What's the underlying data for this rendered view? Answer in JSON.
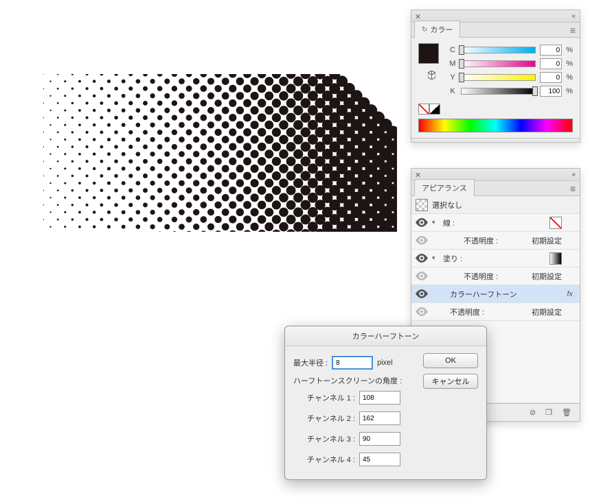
{
  "panels": {
    "color": {
      "tab_label": "カラー",
      "channels": {
        "c": {
          "label": "C",
          "value": "0",
          "pct": "%"
        },
        "m": {
          "label": "M",
          "value": "0",
          "pct": "%"
        },
        "y": {
          "label": "Y",
          "value": "0",
          "pct": "%"
        },
        "k": {
          "label": "K",
          "value": "100",
          "pct": "%"
        }
      }
    },
    "appearance": {
      "tab_label": "アピアランス",
      "selection_label": "選択なし",
      "rows": {
        "stroke_label": "線 :",
        "opacity_label": "不透明度 :",
        "opacity_value": "初期設定",
        "fill_label": "塗り :",
        "effect_label": "カラーハーフトーン"
      }
    }
  },
  "dialog": {
    "title": "カラーハーフトーン",
    "max_radius_label": "最大半径 :",
    "max_radius_value": "8",
    "max_radius_unit": "pixel",
    "angles_label": "ハーフトーンスクリーンの角度 :",
    "channels": [
      {
        "label": "チャンネル 1 :",
        "value": "108"
      },
      {
        "label": "チャンネル 2 :",
        "value": "162"
      },
      {
        "label": "チャンネル 3 :",
        "value": "90"
      },
      {
        "label": "チャンネル 4 :",
        "value": "45"
      }
    ],
    "ok_label": "OK",
    "cancel_label": "キャンセル"
  }
}
